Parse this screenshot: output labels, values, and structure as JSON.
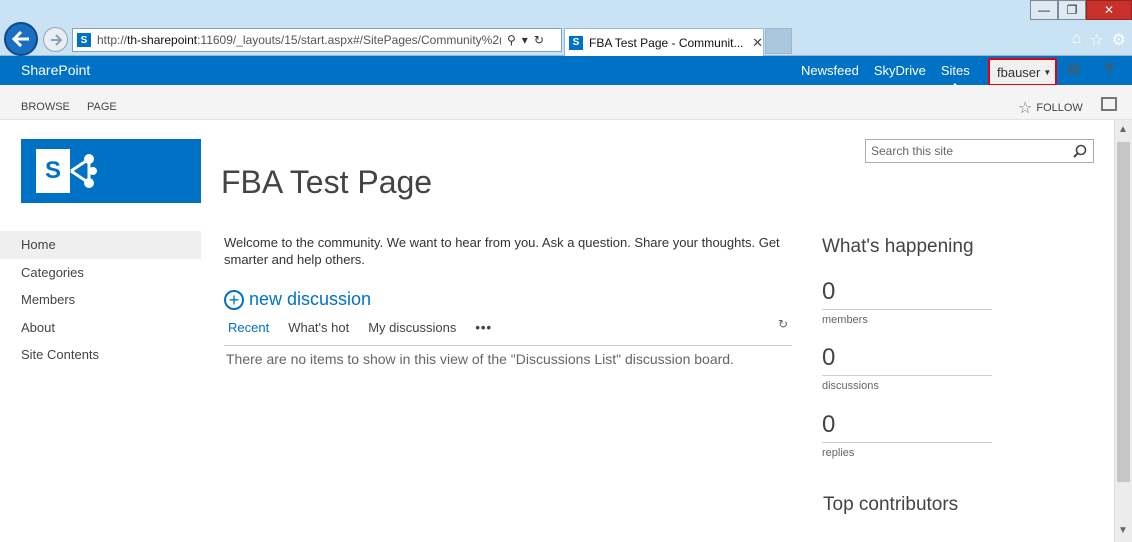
{
  "browser": {
    "url_prefix": "http://",
    "url_host": "th-sharepoint",
    "url_rest": ":11609/_layouts/15/start.aspx#/SitePages/Community%2(",
    "tab_title": "FBA Test Page - Communit...",
    "favicon_letter": "S"
  },
  "suite": {
    "brand": "SharePoint",
    "links": [
      "Newsfeed",
      "SkyDrive",
      "Sites"
    ],
    "user": "fbauser",
    "help": "?"
  },
  "ribbon": {
    "tabs": [
      "BROWSE",
      "PAGE"
    ],
    "follow": "FOLLOW"
  },
  "page": {
    "title": "FBA Test Page",
    "logo_letter": "S",
    "search_placeholder": "Search this site"
  },
  "quicklaunch": [
    "Home",
    "Categories",
    "Members",
    "About",
    "Site Contents"
  ],
  "main": {
    "welcome": "Welcome to the community. We want to hear from you. Ask a question. Share your thoughts. Get smarter and help others.",
    "new_discussion": "new discussion",
    "views": [
      "Recent",
      "What's hot",
      "My discussions"
    ],
    "more": "•••",
    "empty": "There are no items to show in this view of the \"Discussions List\" discussion board."
  },
  "sidebar": {
    "happening_title": "What's happening",
    "stats": [
      {
        "value": "0",
        "label": "members"
      },
      {
        "value": "0",
        "label": "discussions"
      },
      {
        "value": "0",
        "label": "replies"
      }
    ],
    "contributors_title": "Top contributors"
  },
  "colors": {
    "accent": "#0072c6",
    "highlight_border": "#e3000f"
  }
}
